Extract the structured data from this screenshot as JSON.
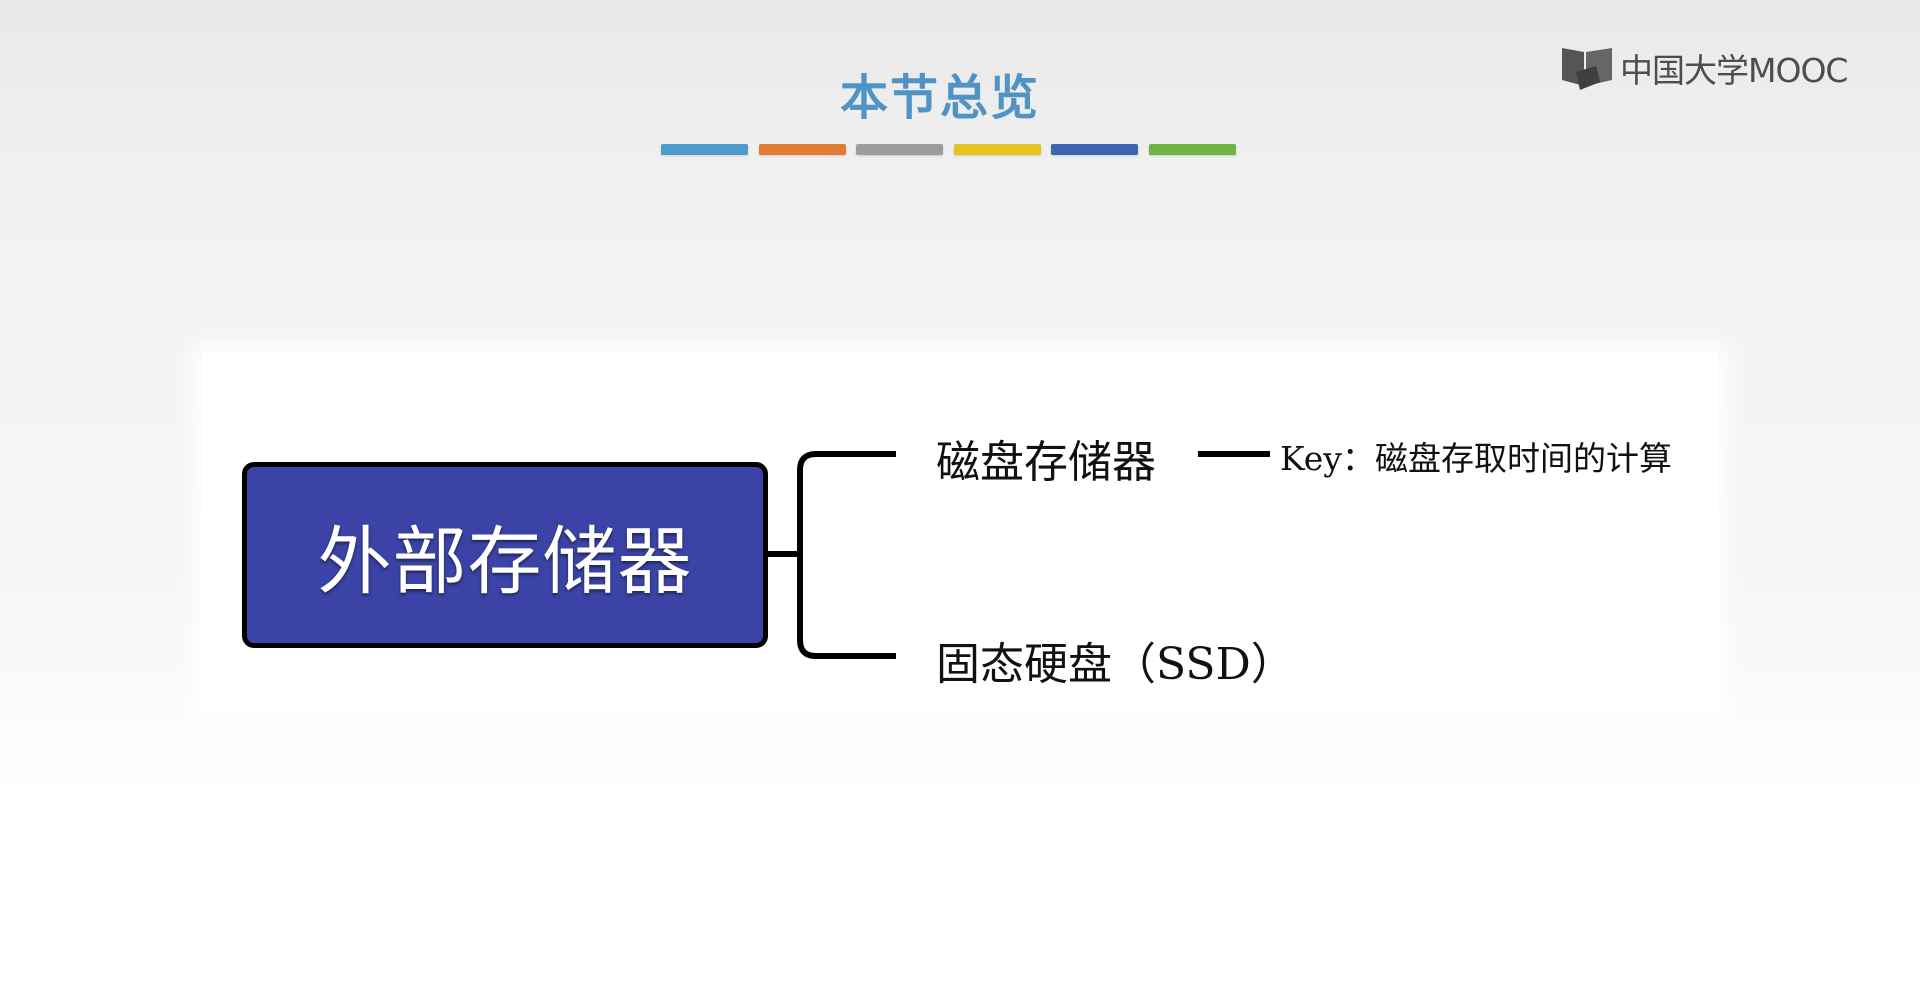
{
  "logo": {
    "text": "中国大学MOOC",
    "icon": "mooc-logo-icon"
  },
  "title": "本节总览",
  "color_bar": [
    "#4d9ccc",
    "#e07a35",
    "#9c9c9c",
    "#e6c41f",
    "#3d66b0",
    "#6cb542"
  ],
  "diagram": {
    "root": {
      "label": "外部存储器",
      "fill": "#3b44a6"
    },
    "branches": [
      {
        "label": "磁盘存储器",
        "note": "Key：磁盘存取时间的计算"
      },
      {
        "label": "固态硬盘（SSD）"
      }
    ]
  }
}
